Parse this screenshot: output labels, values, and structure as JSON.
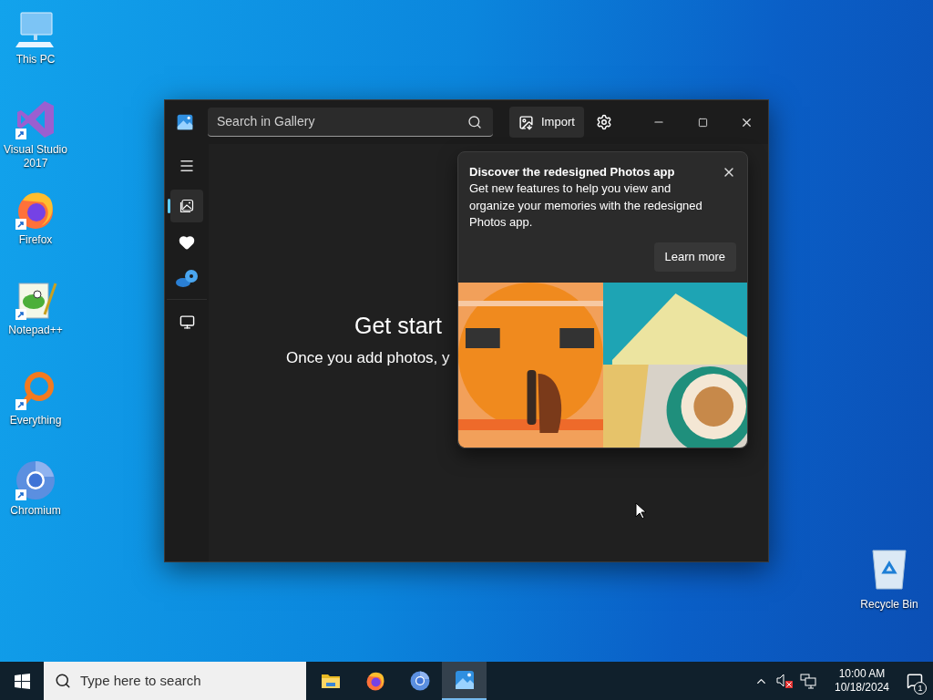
{
  "desktop_icons": [
    {
      "label": "This PC",
      "kind": "pc",
      "shortcut": false
    },
    {
      "label": "Visual Studio 2017",
      "kind": "visual-studio",
      "shortcut": true
    },
    {
      "label": "Firefox",
      "kind": "firefox",
      "shortcut": true
    },
    {
      "label": "Notepad++",
      "kind": "notepad",
      "shortcut": true
    },
    {
      "label": "Everything",
      "kind": "everything",
      "shortcut": true
    },
    {
      "label": "Chromium",
      "kind": "chromium",
      "shortcut": true
    }
  ],
  "recycle_bin": {
    "label": "Recycle Bin"
  },
  "window": {
    "search": {
      "placeholder": "Search in Gallery"
    },
    "import_button": "Import",
    "sidebar": {
      "items": [
        {
          "kind": "gallery",
          "selected": true
        },
        {
          "kind": "favorites",
          "selected": false
        },
        {
          "kind": "cloud",
          "selected": false
        },
        {
          "kind": "pc",
          "selected": false
        }
      ]
    },
    "empty_state": {
      "title": "Get start",
      "message": "Once you add photos, y"
    },
    "popup": {
      "title": "Discover the redesigned Photos app",
      "body": "Get new features to help you view and organize your memories with the redesigned Photos app.",
      "button": "Learn more"
    }
  },
  "taskbar": {
    "search_placeholder": "Type here to search",
    "apps": [
      {
        "kind": "explorer",
        "selected": false
      },
      {
        "kind": "firefox",
        "selected": false
      },
      {
        "kind": "chromium",
        "selected": false
      },
      {
        "kind": "photos",
        "selected": true
      }
    ],
    "clock": {
      "time": "10:00 AM",
      "date": "10/18/2024"
    },
    "notifications": {
      "count": "1"
    }
  }
}
